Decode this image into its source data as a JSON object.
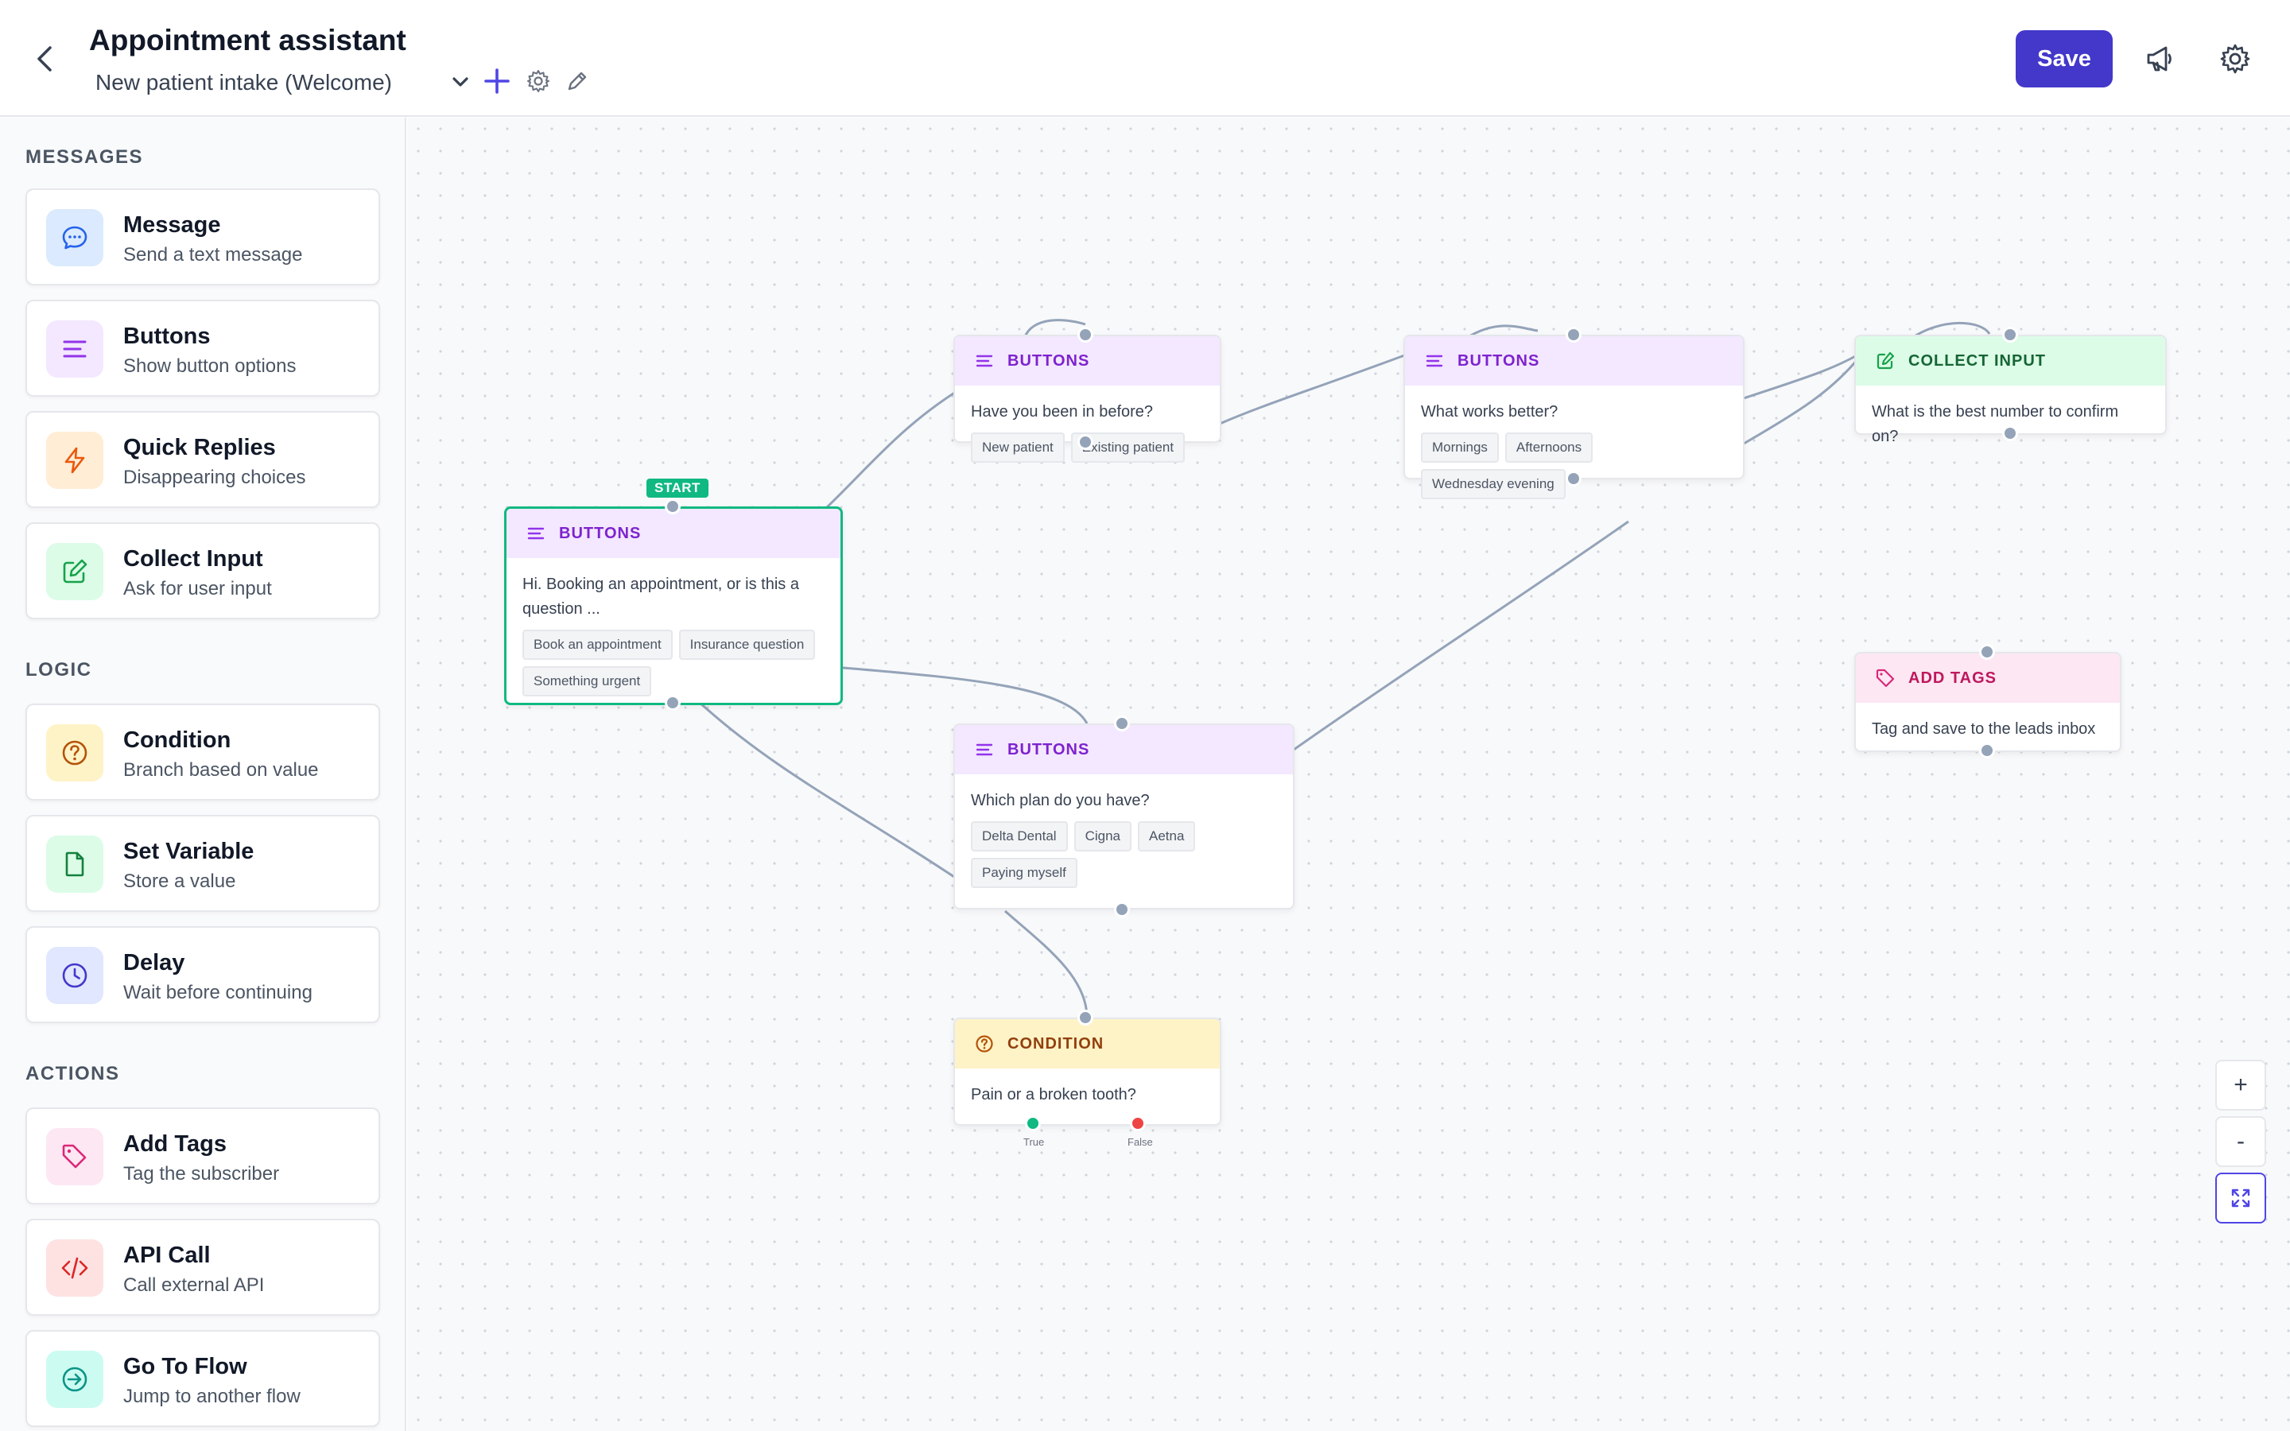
{
  "header": {
    "title": "Appointment assistant",
    "flow_name": "New patient intake (Welcome)",
    "save_label": "Save"
  },
  "sidebar": {
    "sections": {
      "messages": "MESSAGES",
      "logic": "LOGIC",
      "actions": "ACTIONS"
    },
    "items": [
      {
        "title": "Message",
        "subtitle": "Send a text message",
        "icon": "chat-bubble-icon",
        "color": "#2563eb",
        "bg": "#dbeafe"
      },
      {
        "title": "Buttons",
        "subtitle": "Show button options",
        "icon": "list-lines-icon",
        "color": "#9333ea",
        "bg": "#f3e8ff"
      },
      {
        "title": "Quick Replies",
        "subtitle": "Disappearing choices",
        "icon": "lightning-icon",
        "color": "#ea580c",
        "bg": "#ffedd5"
      },
      {
        "title": "Collect Input",
        "subtitle": "Ask for user input",
        "icon": "edit-icon",
        "color": "#16a34a",
        "bg": "#dcfce7"
      },
      {
        "title": "Condition",
        "subtitle": "Branch based on value",
        "icon": "question-circle-icon",
        "color": "#b45309",
        "bg": "#fef3c7"
      },
      {
        "title": "Set Variable",
        "subtitle": "Store a value",
        "icon": "file-icon",
        "color": "#15803d",
        "bg": "#dcfce7"
      },
      {
        "title": "Delay",
        "subtitle": "Wait before continuing",
        "icon": "clock-icon",
        "color": "#4338ca",
        "bg": "#e0e7ff"
      },
      {
        "title": "Add Tags",
        "subtitle": "Tag the subscriber",
        "icon": "tag-icon",
        "color": "#db2777",
        "bg": "#fce7f3"
      },
      {
        "title": "API Call",
        "subtitle": "Call external API",
        "icon": "code-icon",
        "color": "#dc2626",
        "bg": "#fee2e2"
      },
      {
        "title": "Go To Flow",
        "subtitle": "Jump to another flow",
        "icon": "arrow-circle-icon",
        "color": "#0d9488",
        "bg": "#ccfbf1"
      }
    ]
  },
  "canvas": {
    "start_label": "START",
    "nodes": {
      "start": {
        "type": "BUTTONS",
        "text": "Hi. Booking an appointment, or is this a question ...",
        "chips": [
          "Book an appointment",
          "Insurance question",
          "Something urgent"
        ]
      },
      "visited": {
        "type": "BUTTONS",
        "text": "Have you been in before?",
        "chips": [
          "New patient",
          "Existing patient"
        ]
      },
      "timing": {
        "type": "BUTTONS",
        "text": "What works better?",
        "chips": [
          "Mornings",
          "Afternoons",
          "Wednesday evening"
        ]
      },
      "collect": {
        "type": "COLLECT INPUT",
        "text": "What is the best number to confirm on?"
      },
      "tags": {
        "type": "ADD TAGS",
        "text": "Tag and save to the leads inbox"
      },
      "plan": {
        "type": "BUTTONS",
        "text": "Which plan do you have?",
        "chips": [
          "Delta Dental",
          "Cigna",
          "Aetna",
          "Paying myself"
        ]
      },
      "condition": {
        "type": "CONDITION",
        "text": "Pain or a broken tooth?",
        "true_label": "True",
        "false_label": "False"
      }
    },
    "zoom": {
      "in": "+",
      "out": "-"
    }
  }
}
